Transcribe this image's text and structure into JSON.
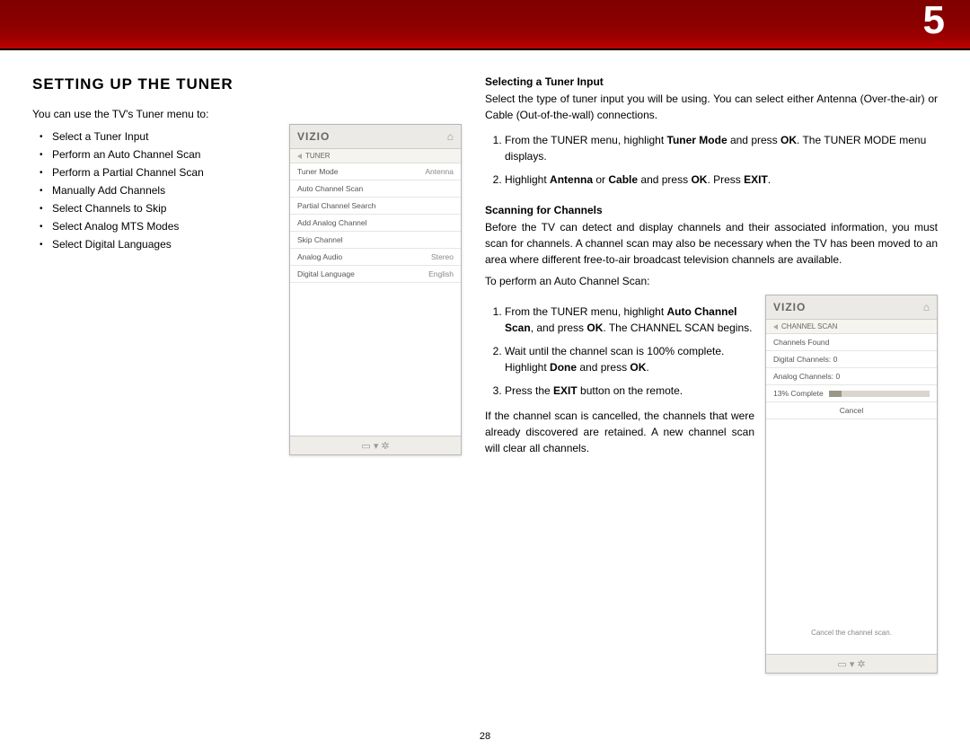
{
  "chapter": "5",
  "page_number": "28",
  "left": {
    "heading": "SETTING UP THE TUNER",
    "intro": "You can use the TV's Tuner menu to:",
    "bullets": [
      "Select a Tuner Input",
      "Perform an Auto Channel Scan",
      "Perform a Partial Channel Scan",
      "Manually Add Channels",
      "Select Channels to Skip",
      "Select Analog MTS Modes",
      "Select Digital Languages"
    ]
  },
  "tuner_screen": {
    "logo": "VIZIO",
    "home_icon": "⌂",
    "crumb": "TUNER",
    "rows": [
      {
        "label": "Tuner Mode",
        "value": "Antenna"
      },
      {
        "label": "Auto Channel Scan",
        "value": ""
      },
      {
        "label": "Partial Channel Search",
        "value": ""
      },
      {
        "label": "Add Analog Channel",
        "value": ""
      },
      {
        "label": "Skip Channel",
        "value": ""
      },
      {
        "label": "Analog Audio",
        "value": "Stereo"
      },
      {
        "label": "Digital Language",
        "value": "English"
      }
    ],
    "footer_icons": "▭   ▾   ✲"
  },
  "right": {
    "sub1": "Selecting a Tuner Input",
    "p1": "Select the type of tuner input you will be using. You can select either Antenna (Over-the-air) or Cable (Out-of-the-wall) connections.",
    "steps1": [
      {
        "pre": "From the TUNER menu, highlight ",
        "b1": "Tuner Mode",
        "mid": " and press ",
        "b2": "OK",
        "post": ". The TUNER MODE menu displays."
      },
      {
        "pre": "Highlight ",
        "b1": "Antenna",
        "mid": " or ",
        "b2": "Cable",
        "mid2": " and press ",
        "b3": "OK",
        "mid3": ". Press ",
        "b4": "EXIT",
        "post": "."
      }
    ],
    "sub2": "Scanning for Channels",
    "p2": "Before the TV can detect and display channels and their associated information, you must scan for channels. A channel scan may also be necessary when the TV has been moved to an area where different free-to-air broadcast television channels are available.",
    "p3": "To perform an Auto Channel Scan:",
    "steps2": [
      {
        "pre": "From the TUNER menu, highlight ",
        "b1": "Auto Channel Scan",
        "mid": ", and press ",
        "b2": "OK",
        "post": ". The CHANNEL SCAN begins."
      },
      {
        "pre": "Wait until the channel scan is 100% complete. Highlight ",
        "b1": "Done",
        "mid": " and press ",
        "b2": "OK",
        "post": "."
      },
      {
        "pre": "Press the ",
        "b1": "EXIT",
        "post": " button on the remote."
      }
    ],
    "p4": "If the channel scan is cancelled, the channels that were already discovered are retained. A new channel scan will clear all channels."
  },
  "scan_screen": {
    "logo": "VIZIO",
    "home_icon": "⌂",
    "crumb": "CHANNEL SCAN",
    "rows": [
      {
        "label": "Channels Found",
        "value": ""
      },
      {
        "label": "Digital Channels: 0",
        "value": ""
      },
      {
        "label": "Analog Channels: 0",
        "value": ""
      }
    ],
    "progress_label": "13% Complete",
    "cancel": "Cancel",
    "hint": "Cancel the channel scan.",
    "footer_icons": "▭   ▾   ✲"
  }
}
